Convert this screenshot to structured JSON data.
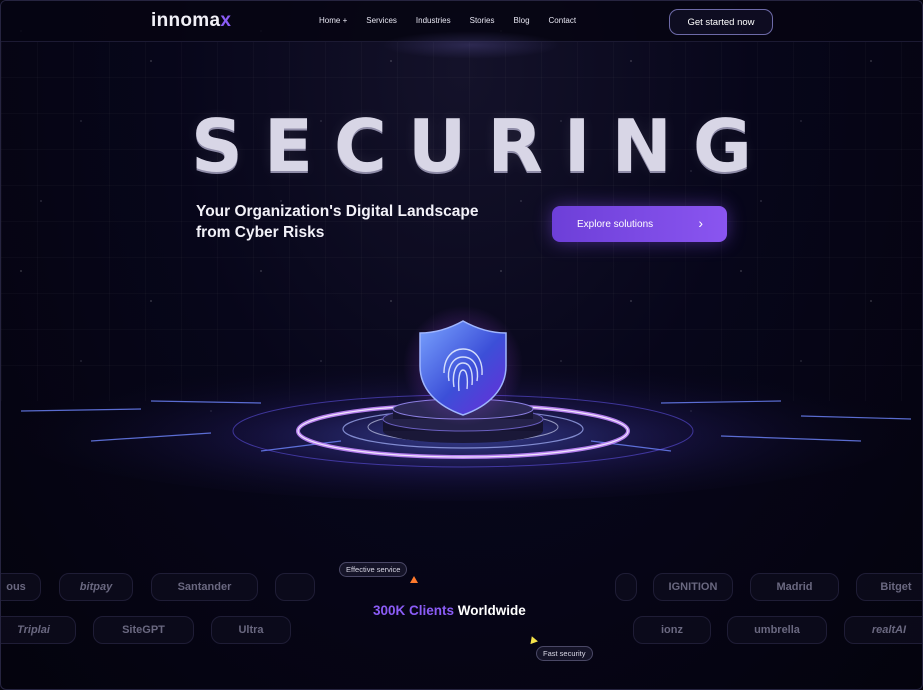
{
  "brand": {
    "name_main": "innoma",
    "name_accent": "x",
    "accent_color": "#8b5cf6"
  },
  "nav": {
    "items": [
      {
        "label": "Home +"
      },
      {
        "label": "Services"
      },
      {
        "label": "Industries"
      },
      {
        "label": "Stories"
      },
      {
        "label": "Blog"
      },
      {
        "label": "Contact"
      }
    ],
    "cta_label": "Get started now"
  },
  "hero": {
    "headline": "SECURING",
    "subline_1": "Your Organization's Digital Landscape",
    "subline_2": "from Cyber Risks",
    "explore_label": "Explore solutions",
    "explore_icon": "chevron-right-icon"
  },
  "clients": {
    "count_highlight": "300K Clients",
    "count_rest": " Worldwide",
    "tag_1": "Effective service",
    "tag_2": "Fast security",
    "logos_row_1": [
      "ous",
      "bitpay",
      "Santander",
      "IGNITION",
      "Madrid",
      "Bitget"
    ],
    "logos_row_2": [
      "Triplai",
      "SiteGPT",
      "Ultra",
      "ionz",
      "umbrella",
      "realtAI"
    ]
  }
}
